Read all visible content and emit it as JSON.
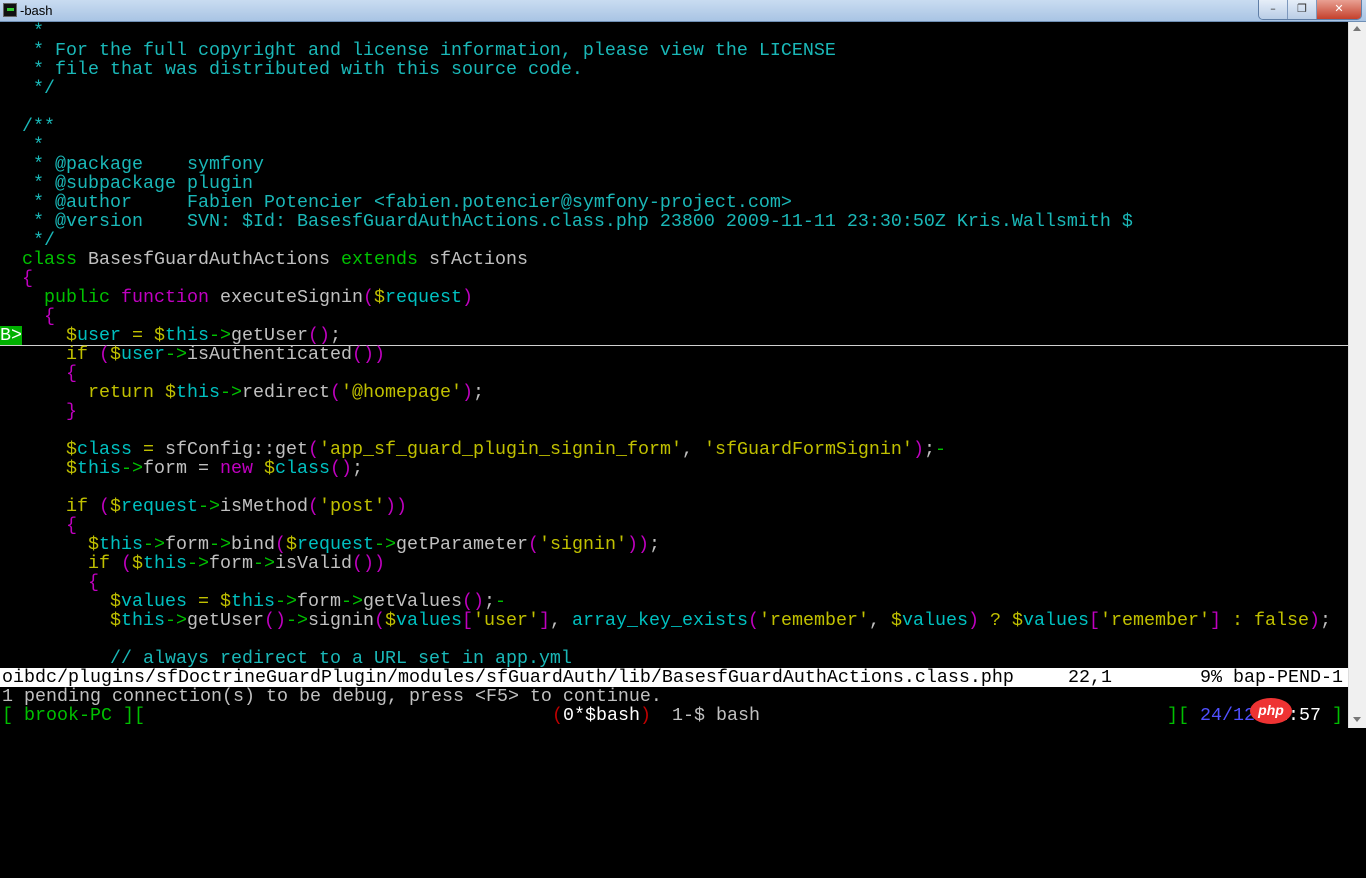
{
  "window": {
    "title": "-bash",
    "buttons": {
      "minimize": "–",
      "restore": "❐",
      "close": "✕"
    }
  },
  "palette": {
    "c": "#1ab8b8",
    "g": "#00c000",
    "m": "#c000c0",
    "y": "#c0c000",
    "w": "#c0c0c0",
    "v": "#00c0c0",
    "r": "#c00000",
    "b": "#5050ff",
    "W": "#ffffff"
  },
  "editor": {
    "sign_label": "B>",
    "cursor_line": 16,
    "lines": [
      [
        [
          " *",
          "c"
        ]
      ],
      [
        [
          " * For the full copyright and license information, please view the LICENSE",
          "c"
        ]
      ],
      [
        [
          " * file that was distributed with this source code.",
          "c"
        ]
      ],
      [
        [
          " */",
          "c"
        ]
      ],
      [],
      [
        [
          "/**",
          "c"
        ]
      ],
      [
        [
          " *",
          "c"
        ]
      ],
      [
        [
          " * @package    symfony",
          "c"
        ]
      ],
      [
        [
          " * @subpackage plugin",
          "c"
        ]
      ],
      [
        [
          " * @author     Fabien Potencier <fabien.potencier@symfony-project.com>",
          "c"
        ]
      ],
      [
        [
          " * @version    SVN: $Id: BasesfGuardAuthActions.class.php 23800 2009-11-11 23:30:50Z Kris.Wallsmith $",
          "c"
        ]
      ],
      [
        [
          " */",
          "c"
        ]
      ],
      [
        [
          "class",
          "g"
        ],
        [
          " BasesfGuardAuthActions ",
          "w"
        ],
        [
          "extends",
          "g"
        ],
        [
          " sfActions",
          "w"
        ]
      ],
      [
        [
          "{",
          "m"
        ]
      ],
      [
        [
          "  ",
          "w"
        ],
        [
          "public",
          "g"
        ],
        [
          " ",
          "w"
        ],
        [
          "function",
          "m"
        ],
        [
          " executeSignin",
          "w"
        ],
        [
          "(",
          "m"
        ],
        [
          "$",
          "y"
        ],
        [
          "request",
          "v"
        ],
        [
          ")",
          "m"
        ]
      ],
      [
        [
          "  ",
          "w"
        ],
        [
          "{",
          "m"
        ]
      ],
      [
        [
          "    ",
          "w"
        ],
        [
          "$",
          "y"
        ],
        [
          "user",
          "v"
        ],
        [
          " = ",
          "y"
        ],
        [
          "$",
          "y"
        ],
        [
          "this",
          "v"
        ],
        [
          "->",
          "g"
        ],
        [
          "getUser",
          "w"
        ],
        [
          "()",
          "m"
        ],
        [
          ";",
          "w"
        ]
      ],
      [
        [
          "    ",
          "w"
        ],
        [
          "if",
          "y"
        ],
        [
          " ",
          "w"
        ],
        [
          "(",
          "m"
        ],
        [
          "$",
          "y"
        ],
        [
          "user",
          "v"
        ],
        [
          "->",
          "g"
        ],
        [
          "isAuthenticated",
          "w"
        ],
        [
          "())",
          "m"
        ]
      ],
      [
        [
          "    ",
          "w"
        ],
        [
          "{",
          "m"
        ]
      ],
      [
        [
          "      ",
          "w"
        ],
        [
          "return",
          "y"
        ],
        [
          " ",
          "w"
        ],
        [
          "$",
          "y"
        ],
        [
          "this",
          "v"
        ],
        [
          "->",
          "g"
        ],
        [
          "redirect",
          "w"
        ],
        [
          "(",
          "m"
        ],
        [
          "'@homepage'",
          "y"
        ],
        [
          ")",
          "m"
        ],
        [
          ";",
          "w"
        ]
      ],
      [
        [
          "    ",
          "w"
        ],
        [
          "}",
          "m"
        ]
      ],
      [],
      [
        [
          "    ",
          "w"
        ],
        [
          "$",
          "y"
        ],
        [
          "class",
          "v"
        ],
        [
          " = ",
          "y"
        ],
        [
          "sfConfig::get",
          "w"
        ],
        [
          "(",
          "m"
        ],
        [
          "'app_sf_guard_plugin_signin_form'",
          "y"
        ],
        [
          ", ",
          "w"
        ],
        [
          "'sfGuardFormSignin'",
          "y"
        ],
        [
          ")",
          "m"
        ],
        [
          ";",
          "w"
        ],
        [
          "-",
          "g"
        ]
      ],
      [
        [
          "    ",
          "w"
        ],
        [
          "$",
          "y"
        ],
        [
          "this",
          "v"
        ],
        [
          "->",
          "g"
        ],
        [
          "form = ",
          "w"
        ],
        [
          "new",
          "m"
        ],
        [
          " ",
          "w"
        ],
        [
          "$",
          "y"
        ],
        [
          "class",
          "v"
        ],
        [
          "()",
          "m"
        ],
        [
          ";",
          "w"
        ]
      ],
      [],
      [
        [
          "    ",
          "w"
        ],
        [
          "if",
          "y"
        ],
        [
          " ",
          "w"
        ],
        [
          "(",
          "m"
        ],
        [
          "$",
          "y"
        ],
        [
          "request",
          "v"
        ],
        [
          "->",
          "g"
        ],
        [
          "isMethod",
          "w"
        ],
        [
          "(",
          "m"
        ],
        [
          "'post'",
          "y"
        ],
        [
          "))",
          "m"
        ]
      ],
      [
        [
          "    ",
          "w"
        ],
        [
          "{",
          "m"
        ]
      ],
      [
        [
          "      ",
          "w"
        ],
        [
          "$",
          "y"
        ],
        [
          "this",
          "v"
        ],
        [
          "->",
          "g"
        ],
        [
          "form",
          "w"
        ],
        [
          "->",
          "g"
        ],
        [
          "bind",
          "w"
        ],
        [
          "(",
          "m"
        ],
        [
          "$",
          "y"
        ],
        [
          "request",
          "v"
        ],
        [
          "->",
          "g"
        ],
        [
          "getParameter",
          "w"
        ],
        [
          "(",
          "m"
        ],
        [
          "'signin'",
          "y"
        ],
        [
          "))",
          "m"
        ],
        [
          ";",
          "w"
        ]
      ],
      [
        [
          "      ",
          "w"
        ],
        [
          "if",
          "y"
        ],
        [
          " ",
          "w"
        ],
        [
          "(",
          "m"
        ],
        [
          "$",
          "y"
        ],
        [
          "this",
          "v"
        ],
        [
          "->",
          "g"
        ],
        [
          "form",
          "w"
        ],
        [
          "->",
          "g"
        ],
        [
          "isValid",
          "w"
        ],
        [
          "())",
          "m"
        ]
      ],
      [
        [
          "      ",
          "w"
        ],
        [
          "{",
          "m"
        ]
      ],
      [
        [
          "        ",
          "w"
        ],
        [
          "$",
          "y"
        ],
        [
          "values",
          "v"
        ],
        [
          " = ",
          "y"
        ],
        [
          "$",
          "y"
        ],
        [
          "this",
          "v"
        ],
        [
          "->",
          "g"
        ],
        [
          "form",
          "w"
        ],
        [
          "->",
          "g"
        ],
        [
          "getValues",
          "w"
        ],
        [
          "()",
          "m"
        ],
        [
          ";",
          "w"
        ],
        [
          "-",
          "g"
        ]
      ],
      [
        [
          "        ",
          "w"
        ],
        [
          "$",
          "y"
        ],
        [
          "this",
          "v"
        ],
        [
          "->",
          "g"
        ],
        [
          "getUser",
          "w"
        ],
        [
          "()",
          "m"
        ],
        [
          "->",
          "g"
        ],
        [
          "signin",
          "w"
        ],
        [
          "(",
          "m"
        ],
        [
          "$",
          "y"
        ],
        [
          "values",
          "v"
        ],
        [
          "[",
          "m"
        ],
        [
          "'user'",
          "y"
        ],
        [
          "]",
          "m"
        ],
        [
          ", ",
          "w"
        ],
        [
          "array_key_exists",
          "v"
        ],
        [
          "(",
          "m"
        ],
        [
          "'remember'",
          "y"
        ],
        [
          ", ",
          "w"
        ],
        [
          "$",
          "y"
        ],
        [
          "values",
          "v"
        ],
        [
          ")",
          "m"
        ],
        [
          " ? ",
          "y"
        ],
        [
          "$",
          "y"
        ],
        [
          "values",
          "v"
        ],
        [
          "[",
          "m"
        ],
        [
          "'remember'",
          "y"
        ],
        [
          "]",
          "m"
        ],
        [
          " : false",
          "y"
        ],
        [
          ")",
          "m"
        ],
        [
          ";",
          "w"
        ]
      ],
      [],
      [
        [
          "        // always redirect to a URL set in app.yml",
          "c"
        ]
      ]
    ]
  },
  "statusline": {
    "path": "oibdc/plugins/sfDoctrineGuardPlugin/modules/sfGuardAuth/lib/BasesfGuardAuthActions.class.php",
    "position": "22,1",
    "percent": "9%",
    "mode": "bap-PEND-1"
  },
  "message": "1 pending connection(s) to be debug, press <F5> to continue.",
  "tmux": {
    "left": "[ brook-PC ][",
    "window0": {
      "open": "(",
      "label": "0*$bash",
      "close": ")"
    },
    "window1": "1-$ bash",
    "right_open": "][ ",
    "date": "24/12",
    "time": "22:57",
    "right_close": " ]"
  },
  "watermark": "php"
}
